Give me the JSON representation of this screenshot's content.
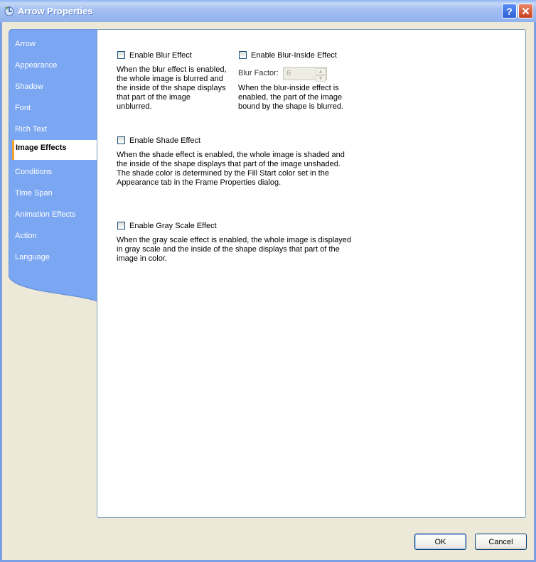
{
  "window": {
    "title": "Arrow Properties",
    "help_label": "?",
    "close_label": "✕"
  },
  "sidebar": {
    "items": [
      {
        "label": "Arrow"
      },
      {
        "label": "Appearance"
      },
      {
        "label": "Shadow"
      },
      {
        "label": "Font"
      },
      {
        "label": "Rich Text"
      },
      {
        "label": "Image Effects",
        "selected": true
      },
      {
        "label": "Conditions"
      },
      {
        "label": "Time Span"
      },
      {
        "label": "Animation Effects"
      },
      {
        "label": "Action"
      },
      {
        "label": "Language"
      }
    ]
  },
  "effects": {
    "blur": {
      "label": "Enable Blur Effect",
      "checked": false,
      "description": "When the blur effect is enabled,\nthe whole image is blurred and\nthe inside of the shape displays\nthat part of the image\nunblurred."
    },
    "blur_inside": {
      "label": "Enable Blur-Inside Effect",
      "checked": false,
      "factor_label": "Blur Factor:",
      "factor_value": "6",
      "description": "When the blur-inside effect is\nenabled, the part of the image\nbound by the shape is blurred."
    },
    "shade": {
      "label": "Enable Shade Effect",
      "checked": false,
      "description": "When the shade effect is enabled, the whole image is shaded and\nthe inside of the shape displays that part of the image unshaded.\nThe shade color is determined by the Fill Start color set in the\nAppearance tab in the Frame Properties dialog."
    },
    "gray_scale": {
      "label": "Enable Gray Scale Effect",
      "checked": false,
      "description": "When the gray scale effect is enabled, the whole image is displayed\nin gray scale and the inside of the shape displays that part of the\nimage in color."
    }
  },
  "buttons": {
    "ok": "OK",
    "cancel": "Cancel"
  },
  "colors": {
    "sidebar": "#7ba6f2",
    "titlebar": "#a6c1f1",
    "accent": "#f0a030"
  }
}
